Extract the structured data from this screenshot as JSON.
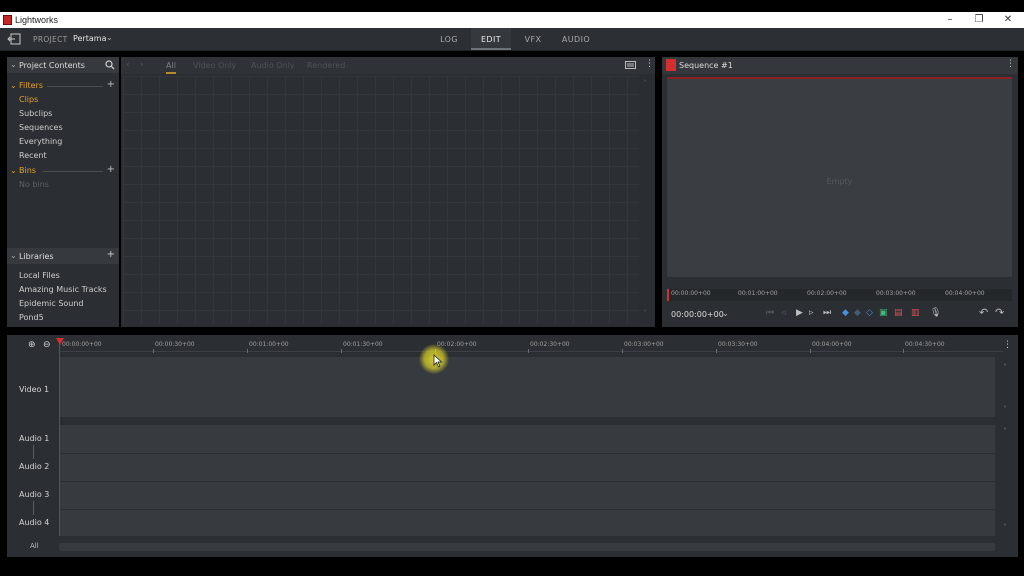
{
  "window": {
    "title": "Lightworks",
    "minimize": "–",
    "restore": "❐",
    "close": "✕"
  },
  "header": {
    "project_label": "PROJECT",
    "project_name": "Pertama",
    "chevron": "⌄",
    "tabs": [
      {
        "label": "LOG",
        "active": false
      },
      {
        "label": "EDIT",
        "active": true
      },
      {
        "label": "VFX",
        "active": false
      },
      {
        "label": "AUDIO",
        "active": false
      }
    ]
  },
  "project_contents": {
    "title": "Project Contents",
    "filters_label": "Filters",
    "filters": [
      "Clips",
      "Subclips",
      "Sequences",
      "Everything",
      "Recent"
    ],
    "bins_label": "Bins",
    "no_bins": "No bins",
    "libraries_title": "Libraries",
    "libraries": [
      "Local Files",
      "Amazing Music Tracks",
      "Epidemic Sound",
      "Pond5"
    ]
  },
  "browser": {
    "tabs": [
      "All",
      "Video Only",
      "Audio Only",
      "Rendered"
    ],
    "active_tab": "All"
  },
  "viewer": {
    "title": "Sequence #1",
    "empty_text": "Empty",
    "ruler": [
      "00:00:00+00",
      "00:01:00+00",
      "00:02:00+00",
      "00:03:00+00",
      "00:04:00+00"
    ],
    "timecode": "00:00:00+00"
  },
  "timeline": {
    "ruler": [
      "00:00:00+00",
      "00:00:30+00",
      "00:01:00+00",
      "00:01:30+00",
      "00:02:00+00",
      "00:02:30+00",
      "00:03:00+00",
      "00:03:30+00",
      "00:04:00+00",
      "00:04:30+00"
    ],
    "tracks": {
      "video": [
        "Video 1"
      ],
      "audio": [
        "Audio 1",
        "Audio 2",
        "Audio 3",
        "Audio 4"
      ]
    },
    "all_label": "All"
  },
  "colors": {
    "accent_orange": "#e0a22b",
    "playhead_red": "#d32f2f",
    "panel_bg": "#2b2e32",
    "cursor_highlight": "#e6dc28"
  }
}
